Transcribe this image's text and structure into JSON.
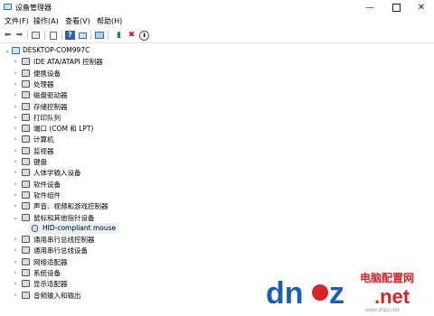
{
  "window": {
    "title": "设备管理器"
  },
  "menu": [
    {
      "label": "文件(F)"
    },
    {
      "label": "操作(A)"
    },
    {
      "label": "查看(V)"
    },
    {
      "label": "帮助(H)"
    }
  ],
  "toolbar": {
    "icons": [
      "back-arrow-icon",
      "forward-arrow-icon",
      "grid-view-icon",
      "properties-icon",
      "help-icon",
      "display-icon",
      "scan-hardware-icon",
      "enable-device-icon",
      "uninstall-icon",
      "download-icon"
    ]
  },
  "tree": {
    "root": "DESKTOP-COM997C",
    "categories": [
      {
        "label": "IDE ATA/ATAPI 控制器",
        "icon": "ide-controller-icon"
      },
      {
        "label": "便携设备",
        "icon": "portable-device-icon"
      },
      {
        "label": "处理器",
        "icon": "processor-icon"
      },
      {
        "label": "磁盘驱动器",
        "icon": "disk-drive-icon"
      },
      {
        "label": "存储控制器",
        "icon": "storage-controller-icon"
      },
      {
        "label": "打印队列",
        "icon": "printer-icon"
      },
      {
        "label": "端口 (COM 和 LPT)",
        "icon": "port-icon"
      },
      {
        "label": "计算机",
        "icon": "computer-icon"
      },
      {
        "label": "监视器",
        "icon": "monitor-icon"
      },
      {
        "label": "键盘",
        "icon": "keyboard-icon"
      },
      {
        "label": "人体学输入设备",
        "icon": "hid-icon"
      },
      {
        "label": "软件设备",
        "icon": "software-device-icon"
      },
      {
        "label": "软件组件",
        "icon": "software-component-icon"
      },
      {
        "label": "声音、视频和游戏控制器",
        "icon": "sound-icon"
      },
      {
        "label": "鼠标和其他指针设备",
        "icon": "mouse-icon",
        "expanded": true,
        "children": [
          {
            "label": "HID-compliant mouse",
            "icon": "mouse-icon"
          }
        ]
      },
      {
        "label": "通用串行总线控制器",
        "icon": "usb-controller-icon"
      },
      {
        "label": "通用串行总线设备",
        "icon": "usb-device-icon"
      },
      {
        "label": "网络适配器",
        "icon": "network-adapter-icon"
      },
      {
        "label": "系统设备",
        "icon": "system-device-icon"
      },
      {
        "label": "显示适配器",
        "icon": "display-adapter-icon"
      },
      {
        "label": "音频输入和输出",
        "icon": "audio-io-icon"
      }
    ]
  },
  "watermark": {
    "brand_left": "dn",
    "brand_mid": "z",
    "brand_right": ".net",
    "tagline": "电脑配置网",
    "url": "www.dnpz.net"
  },
  "colors": {
    "accent": "#0078d7",
    "brand_blue": "#1a5fb4",
    "brand_red": "#d6242a",
    "selection": "#e5f1fb"
  }
}
